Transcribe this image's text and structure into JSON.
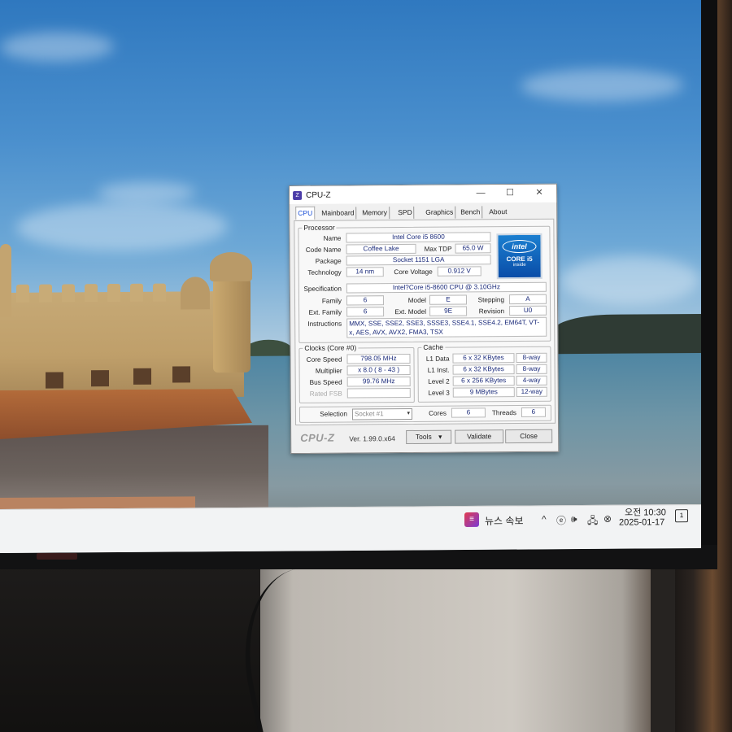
{
  "taskbar": {
    "news_icon_label": "≡",
    "news_label": "뉴스 속보",
    "tray_icons": [
      "chevron-up-icon",
      "app-icon",
      "speaker-icon",
      "network-icon",
      "close-icon"
    ],
    "tray_glyphs": [
      "^",
      "ⓔ",
      "🕪",
      "🖧",
      "⊗"
    ],
    "time": "오전 10:30",
    "date": "2025-01-17",
    "notification_count": "1"
  },
  "cpuz": {
    "title": "CPU-Z",
    "icon_glyph": "Z",
    "window_buttons": {
      "minimize": "—",
      "maximize": "☐",
      "close": "✕"
    },
    "tabs": [
      "CPU",
      "Mainboard",
      "Memory",
      "SPD",
      "Graphics",
      "Bench",
      "About"
    ],
    "processor": {
      "group_title": "Processor",
      "name_label": "Name",
      "name": "Intel Core i5 8600",
      "code_name_label": "Code Name",
      "code_name": "Coffee Lake",
      "max_tdp_label": "Max TDP",
      "max_tdp": "65.0 W",
      "package_label": "Package",
      "package": "Socket 1151 LGA",
      "technology_label": "Technology",
      "technology": "14 nm",
      "core_voltage_label": "Core Voltage",
      "core_voltage": "0.912 V",
      "specification_label": "Specification",
      "specification": "Intel?Core i5-8600 CPU @ 3.10GHz",
      "family_label": "Family",
      "family": "6",
      "model_label": "Model",
      "model": "E",
      "stepping_label": "Stepping",
      "stepping": "A",
      "ext_family_label": "Ext. Family",
      "ext_family": "6",
      "ext_model_label": "Ext. Model",
      "ext_model": "9E",
      "revision_label": "Revision",
      "revision": "U0",
      "instructions_label": "Instructions",
      "instructions": "MMX, SSE, SSE2, SSE3, SSSE3, SSE4.1, SSE4.2, EM64T, VT-x, AES, AVX, AVX2, FMA3, TSX",
      "logo": {
        "brand": "intel",
        "line": "CORE i5",
        "sub": "inside"
      }
    },
    "clocks": {
      "group_title": "Clocks (Core #0)",
      "core_speed_label": "Core Speed",
      "core_speed": "798.05 MHz",
      "multiplier_label": "Multiplier",
      "multiplier": "x 8.0 ( 8 - 43 )",
      "bus_speed_label": "Bus Speed",
      "bus_speed": "99.76 MHz",
      "rated_fsb_label": "Rated FSB",
      "rated_fsb": ""
    },
    "cache": {
      "group_title": "Cache",
      "rows": [
        {
          "label": "L1 Data",
          "size": "6 x 32 KBytes",
          "way": "8-way"
        },
        {
          "label": "L1 Inst.",
          "size": "6 x 32 KBytes",
          "way": "8-way"
        },
        {
          "label": "Level 2",
          "size": "6 x 256 KBytes",
          "way": "4-way"
        },
        {
          "label": "Level 3",
          "size": "9 MBytes",
          "way": "12-way"
        }
      ]
    },
    "selection": {
      "label": "Selection",
      "value": "Socket #1",
      "cores_label": "Cores",
      "cores": "6",
      "threads_label": "Threads",
      "threads": "6"
    },
    "footer": {
      "brand": "CPU-Z",
      "version": "Ver. 1.99.0.x64",
      "tools_label": "Tools",
      "validate_label": "Validate",
      "close_label": "Close"
    }
  }
}
